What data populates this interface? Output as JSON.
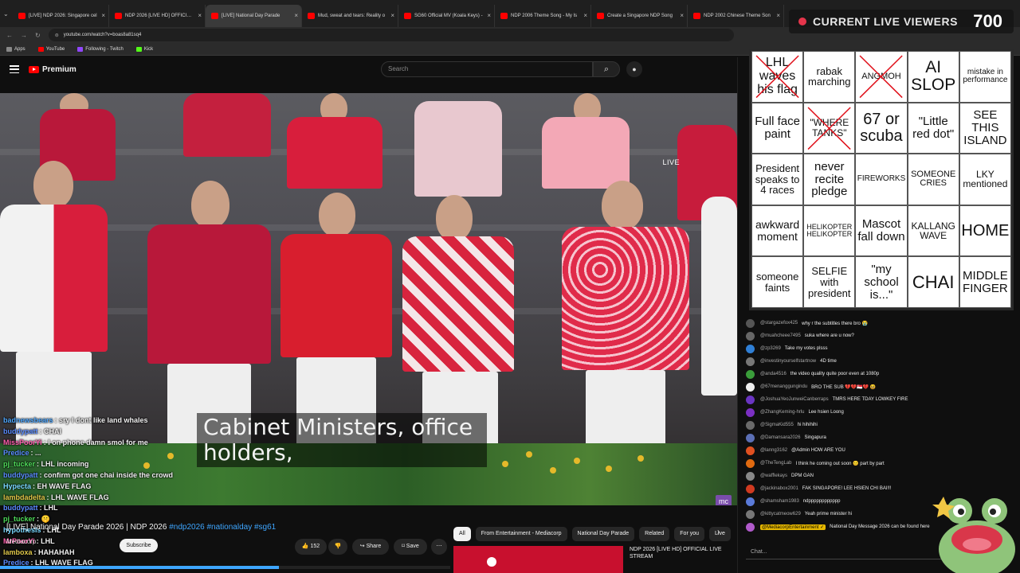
{
  "browser": {
    "tabs": [
      {
        "label": "[LIVE] NDP 2026: Singapore cel",
        "active": false
      },
      {
        "label": "NDP 2026 [LIVE HD] OFFICIAL L",
        "active": false
      },
      {
        "label": "[LIVE] National Day Parade",
        "active": true
      },
      {
        "label": "Mud, sweat and tears: Reality o",
        "active": false
      },
      {
        "label": "SG60 Official MV (Koala Keys) -",
        "active": false
      },
      {
        "label": "NDP 2006 Theme Song - My Is",
        "active": false
      },
      {
        "label": "Create a Singapore NDP Song",
        "active": false
      },
      {
        "label": "NDP 2002 Chinese Theme Son",
        "active": false
      }
    ],
    "url": "youtube.com/watch?v=boas8a81sq4",
    "bookmarks": [
      {
        "label": "Apps",
        "color": "#888888"
      },
      {
        "label": "YouTube",
        "color": "#ff0000"
      },
      {
        "label": "Following - Twitch",
        "color": "#9146ff"
      },
      {
        "label": "Kick",
        "color": "#53fc18"
      }
    ]
  },
  "youtube": {
    "logo_text": "Premium",
    "search_placeholder": "Search"
  },
  "video": {
    "live_badge": "LIVE",
    "subtitle_line1": "Cabinet Ministers, office",
    "subtitle_line2": "holders,",
    "channel_logo": "mc",
    "title_prefix": "[LIVE] National Day Parade 2026 | NDP 2026",
    "title_tags": "#ndp2026 #nationalday #sg61",
    "channel": "Mediacorp",
    "subscribe_label": "Subscribe",
    "likes": "152",
    "share_label": "Share",
    "save_label": "Save",
    "progress_fraction": 0.62
  },
  "overlay_chat": [
    {
      "user": "badnewsbears",
      "color": "#4fa8ff",
      "msg": "sry I dont like land whales"
    },
    {
      "user": "buddypatt",
      "color": "#5b8cff",
      "msg": "CHAI"
    },
    {
      "user": "MissPoorYi",
      "color": "#ff5fae",
      "msg": "I on phone damn smol for me"
    },
    {
      "user": "Predice",
      "color": "#5b8cff",
      "msg": "..."
    },
    {
      "user": "pj_tucker",
      "color": "#4fdc5a",
      "msg": "LHL incoming"
    },
    {
      "user": "buddypatt",
      "color": "#5b8cff",
      "msg": "confirm got one chai inside the crowd"
    },
    {
      "user": "Hypecta",
      "color": "#7ad8ff",
      "msg": "EH WAVE FLAG"
    },
    {
      "user": "lambdadelta",
      "color": "#e0c84a",
      "msg": "LHL WAVE FLAG"
    },
    {
      "user": "buddypatt",
      "color": "#5b8cff",
      "msg": "LHL"
    },
    {
      "user": "pj_tucker",
      "color": "#4fdc5a",
      "msg": "🤫"
    },
    {
      "user": "hypothesis",
      "color": "#7ad8ff",
      "msg": "LHL"
    },
    {
      "user": "MrPoorYi",
      "color": "#ff5fae",
      "msg": "LHL"
    },
    {
      "user": "lamboxa",
      "color": "#e0c84a",
      "msg": "HAHAHAH"
    },
    {
      "user": "Predice",
      "color": "#5b8cff",
      "msg": "LHL WAVE FLAG"
    }
  ],
  "chips": [
    {
      "label": "All",
      "active": true
    },
    {
      "label": "From Entertainment - Mediacorp",
      "active": false
    },
    {
      "label": "National Day Parade",
      "active": false
    },
    {
      "label": "Related",
      "active": false
    },
    {
      "label": "For you",
      "active": false
    },
    {
      "label": "Live",
      "active": false
    }
  ],
  "related": {
    "title": "NDP 2026 [LIVE HD] OFFICIAL LIVE STREAM"
  },
  "viewers": {
    "label": "CURRENT LIVE VIEWERS",
    "count": "700"
  },
  "bingo": [
    {
      "text": "LHL waves his flag",
      "size": 16,
      "crossed": true
    },
    {
      "text": "rabak marching",
      "size": 13,
      "crossed": false
    },
    {
      "text": "ANGMOH",
      "size": 11,
      "crossed": true
    },
    {
      "text": "AI SLOP",
      "size": 21,
      "crossed": false
    },
    {
      "text": "mistake in performance",
      "size": 10,
      "crossed": false
    },
    {
      "text": "Full face paint",
      "size": 15,
      "crossed": false
    },
    {
      "text": "\"WHERE TANKS\"",
      "size": 12,
      "crossed": true
    },
    {
      "text": "67 or scuba",
      "size": 20,
      "crossed": false
    },
    {
      "text": "\"Little red dot\"",
      "size": 15,
      "crossed": false
    },
    {
      "text": "SEE THIS ISLAND",
      "size": 15,
      "crossed": false
    },
    {
      "text": "President speaks to 4 races",
      "size": 13,
      "crossed": false
    },
    {
      "text": "never recite pledge",
      "size": 15,
      "crossed": false
    },
    {
      "text": "FIREWORKS",
      "size": 10,
      "crossed": false
    },
    {
      "text": "SOMEONE CRIES",
      "size": 11,
      "crossed": false
    },
    {
      "text": "LKY mentioned",
      "size": 12,
      "crossed": false
    },
    {
      "text": "awkward moment",
      "size": 14,
      "crossed": false
    },
    {
      "text": "HELIKOPTER HELIKOPTER",
      "size": 9,
      "crossed": false
    },
    {
      "text": "Mascot fall down",
      "size": 15,
      "crossed": false
    },
    {
      "text": "KALLANG WAVE",
      "size": 12,
      "crossed": false
    },
    {
      "text": "HOME",
      "size": 20,
      "crossed": false
    },
    {
      "text": "someone faints",
      "size": 13,
      "crossed": false
    },
    {
      "text": "SELFIE with president",
      "size": 13,
      "crossed": false
    },
    {
      "text": "\"my school is...\"",
      "size": 15,
      "crossed": false
    },
    {
      "text": "CHAI",
      "size": 22,
      "crossed": false
    },
    {
      "text": "MIDDLE FINGER",
      "size": 15,
      "crossed": false
    }
  ],
  "chat": [
    {
      "name": "@stargazefox425",
      "msg": "why r the subtitles there bro 😭",
      "color": "#555555"
    },
    {
      "name": "@muahcheee7495",
      "msg": "suka where are u now?",
      "color": "#666666"
    },
    {
      "name": "@zp3269",
      "msg": "Take my votes plsss",
      "color": "#2f7fd6"
    },
    {
      "name": "@investinyourselfstartnow",
      "msg": "4D time",
      "color": "#777777"
    },
    {
      "name": "@anda4516",
      "msg": "the video quality quite poor even at 1080p",
      "color": "#3a9d3a"
    },
    {
      "name": "@67menanggungindu",
      "msg": "BRO THE SUB 💔💔🇸🇬💔 😆",
      "color": "#eeeeee"
    },
    {
      "name": "@JoshuaYeoJunweiCanberraps",
      "msg": "TMRS HERE TDAY LOWKEY FIRE",
      "color": "#6a35c2"
    },
    {
      "name": "@ZhangKeming-hrlu",
      "msg": "Lee hsien Loong",
      "color": "#7b2fc2"
    },
    {
      "name": "@SigmaKid555",
      "msg": "hi hihihihi",
      "color": "#6a6a6a"
    },
    {
      "name": "@Damansara2026",
      "msg": "Singapura",
      "color": "#5b6fb5"
    },
    {
      "name": "@lanng3162",
      "msg": "@Admin HOW ARE YOU",
      "color": "#e05020"
    },
    {
      "name": "@TheTengLab",
      "msg": "I think he coming out soon 😐 part by part",
      "color": "#e06a10"
    },
    {
      "name": "@wafflekays",
      "msg": "DPM GAN",
      "color": "#888888"
    },
    {
      "name": "@jackinabox2001",
      "msg": "FAK SINGAPORE! LEE HSIEN CHI BAI!!!",
      "color": "#d03a20"
    },
    {
      "name": "@shamsham1983",
      "msg": "ndpppppppppppp",
      "color": "#5a7ad8"
    },
    {
      "name": "@kittycatmeow629",
      "msg": "Yeah prime minister hi",
      "color": "#777777"
    },
    {
      "name": "@MediacorpEntertainment ✓",
      "msg": "National Day Message 2026 can be found here",
      "color": "#b05acb",
      "mod": true
    }
  ],
  "chat_input_placeholder": "Chat..."
}
